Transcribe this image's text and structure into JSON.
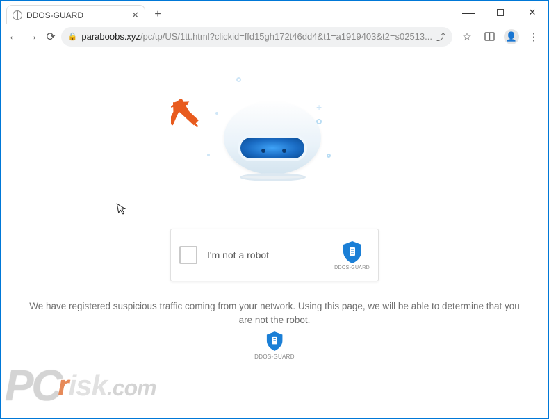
{
  "window": {
    "tab_title": "DDOS-GUARD"
  },
  "address": {
    "domain": "paraboobs.xyz",
    "path": "/pc/tp/US/1tt.html?clickid=ffd15gh172t46dd4&t1=a1919403&t2=s02513..."
  },
  "captcha": {
    "label": "I'm not a robot",
    "brand": "DDOS-GUARD"
  },
  "message": "We have registered suspicious traffic coming from your network. Using this page, we will be able to determine that you are not the robot.",
  "footer_brand": "DDOS-GUARD",
  "watermark": {
    "pc": "PC",
    "risk": "risk",
    "com": ".com"
  }
}
